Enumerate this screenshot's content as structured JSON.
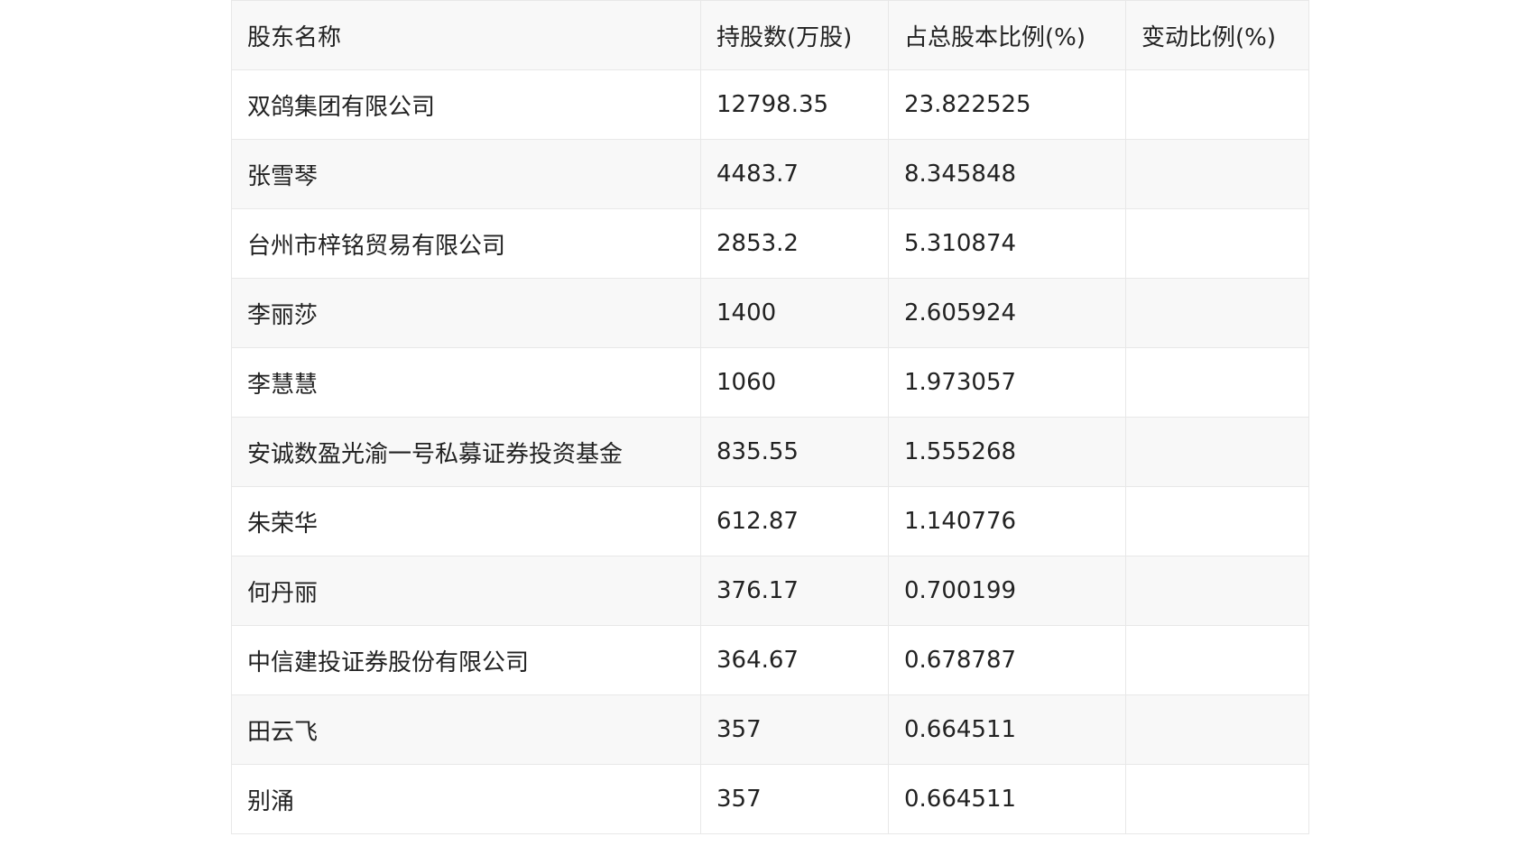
{
  "table": {
    "headers": [
      "股东名称",
      "持股数(万股)",
      "占总股本比例(%)",
      "变动比例(%)"
    ],
    "rows": [
      [
        "双鸽集团有限公司",
        "12798.35",
        "23.822525",
        ""
      ],
      [
        "张雪琴",
        "4483.7",
        "8.345848",
        ""
      ],
      [
        "台州市梓铭贸易有限公司",
        "2853.2",
        "5.310874",
        ""
      ],
      [
        "李丽莎",
        "1400",
        "2.605924",
        ""
      ],
      [
        "李慧慧",
        "1060",
        "1.973057",
        ""
      ],
      [
        "安诚数盈光渝一号私募证券投资基金",
        "835.55",
        "1.555268",
        ""
      ],
      [
        "朱荣华",
        "612.87",
        "1.140776",
        ""
      ],
      [
        "何丹丽",
        "376.17",
        "0.700199",
        ""
      ],
      [
        "中信建投证券股份有限公司",
        "364.67",
        "0.678787",
        ""
      ],
      [
        "田云飞",
        "357",
        "0.664511",
        ""
      ],
      [
        "别涌",
        "357",
        "0.664511",
        ""
      ]
    ]
  }
}
